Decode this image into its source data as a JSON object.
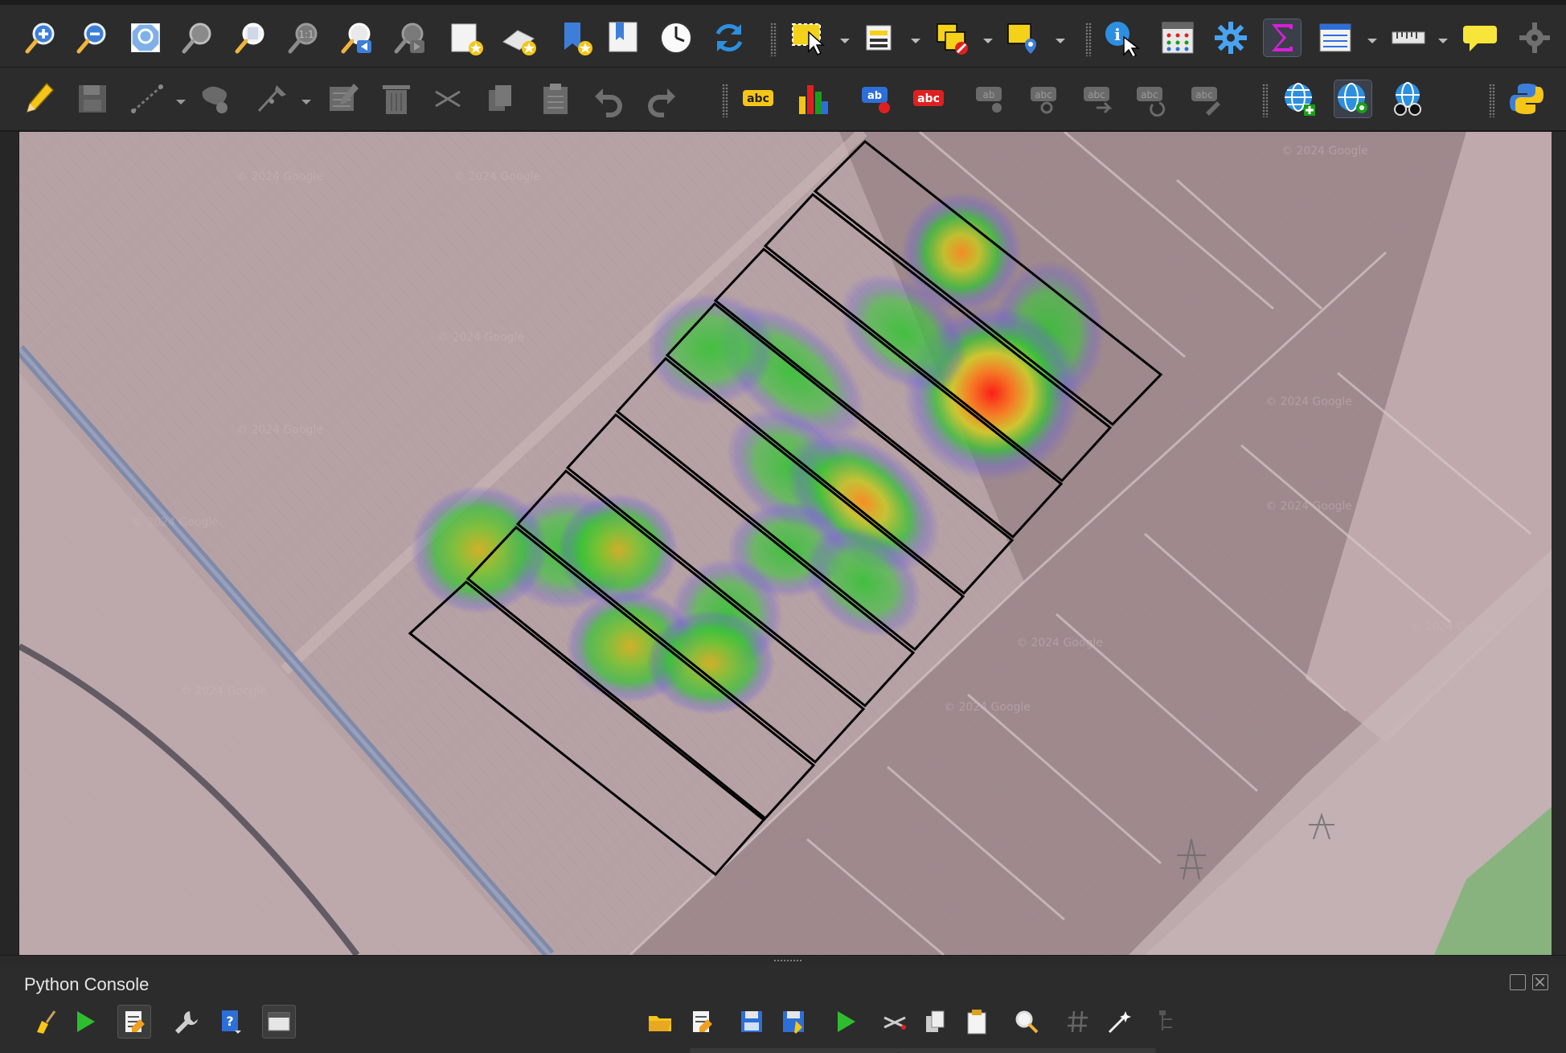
{
  "window": {
    "console_title": "Python Console"
  },
  "toolbar_top": {
    "items": [
      {
        "name": "zoom-in-icon",
        "tip": "Zoom In"
      },
      {
        "name": "zoom-out-icon",
        "tip": "Zoom Out"
      },
      {
        "name": "zoom-full-icon",
        "tip": "Zoom Full"
      },
      {
        "name": "zoom-to-selection-icon",
        "tip": "Zoom to Selection"
      },
      {
        "name": "zoom-to-layer-icon",
        "tip": "Zoom to Layer"
      },
      {
        "name": "zoom-native-resolution-icon",
        "tip": "Zoom to Native Resolution"
      },
      {
        "name": "zoom-last-icon",
        "tip": "Zoom Last"
      },
      {
        "name": "zoom-next-icon",
        "tip": "Zoom Next"
      },
      {
        "name": "new-map-view-icon",
        "tip": "New Map View"
      },
      {
        "name": "new-3d-map-view-icon",
        "tip": "New 3D Map View"
      },
      {
        "name": "new-spatial-bookmark-icon",
        "tip": "New Spatial Bookmark"
      },
      {
        "name": "show-spatial-bookmarks-icon",
        "tip": "Show Spatial Bookmarks"
      },
      {
        "name": "temporal-controller-icon",
        "tip": "Temporal Controller"
      },
      {
        "name": "refresh-icon",
        "tip": "Refresh"
      },
      {
        "name": "select-features-icon",
        "tip": "Select Features"
      },
      {
        "name": "select-by-expression-icon",
        "tip": "Select by Expression"
      },
      {
        "name": "deselect-features-icon",
        "tip": "Deselect Features"
      },
      {
        "name": "select-by-location-icon",
        "tip": "Select by Location"
      },
      {
        "name": "identify-features-icon",
        "tip": "Identify Features"
      },
      {
        "name": "open-attribute-table-icon",
        "tip": "Open Field Calculator"
      },
      {
        "name": "toolbox-gear-icon",
        "tip": "Toolbox"
      },
      {
        "name": "statistical-summary-icon",
        "tip": "Statistical Summary"
      },
      {
        "name": "attribute-table-icon",
        "tip": "Open Attribute Table"
      },
      {
        "name": "measure-line-icon",
        "tip": "Measure Line"
      },
      {
        "name": "map-tips-icon",
        "tip": "Show Map Tips"
      },
      {
        "name": "settings-gear-icon",
        "tip": "Settings"
      }
    ]
  },
  "toolbar_edit": {
    "items": [
      {
        "name": "toggle-editing-pencil-icon",
        "tip": "Toggle Editing"
      },
      {
        "name": "save-edits-icon",
        "tip": "Save Layer Edits"
      },
      {
        "name": "digitize-line-icon",
        "tip": "Add Line Feature"
      },
      {
        "name": "add-polygon-icon",
        "tip": "Add Polygon Feature"
      },
      {
        "name": "vertex-tool-icon",
        "tip": "Vertex Tool"
      },
      {
        "name": "modify-attributes-icon",
        "tip": "Modify Attributes"
      },
      {
        "name": "delete-selected-icon",
        "tip": "Delete Selected"
      },
      {
        "name": "cut-features-icon",
        "tip": "Cut Features"
      },
      {
        "name": "copy-features-icon",
        "tip": "Copy Features"
      },
      {
        "name": "paste-features-icon",
        "tip": "Paste Features"
      },
      {
        "name": "undo-icon",
        "tip": "Undo"
      },
      {
        "name": "redo-icon",
        "tip": "Redo"
      }
    ],
    "label_tool_text": "abc",
    "label_small_text": "ab"
  },
  "console_toolbar": {
    "items": [
      {
        "name": "clear-console-icon"
      },
      {
        "name": "run-command-icon"
      },
      {
        "name": "show-editor-icon"
      },
      {
        "name": "options-wrench-icon"
      },
      {
        "name": "help-icon"
      },
      {
        "name": "dock-window-icon"
      },
      {
        "name": "open-script-icon"
      },
      {
        "name": "open-in-external-editor-icon"
      },
      {
        "name": "save-script-icon"
      },
      {
        "name": "save-as-icon"
      },
      {
        "name": "run-script-icon"
      },
      {
        "name": "cut-icon"
      },
      {
        "name": "copy-icon"
      },
      {
        "name": "paste-icon"
      },
      {
        "name": "find-text-icon"
      },
      {
        "name": "comment-hash-icon"
      },
      {
        "name": "magic-wand-icon"
      },
      {
        "name": "object-inspector-icon"
      }
    ]
  },
  "map": {
    "basemap_watermark": "© 2024 Google",
    "layers": [
      "plots polygon layer",
      "heatmap layer",
      "satellite basemap"
    ]
  },
  "colors": {
    "toolbar_bg": "#2c2c2c",
    "heat_low": "#6b5fd6",
    "heat_mid": "#33c233",
    "heat_high": "#ff2a1a",
    "plot_outline": "#000000"
  }
}
